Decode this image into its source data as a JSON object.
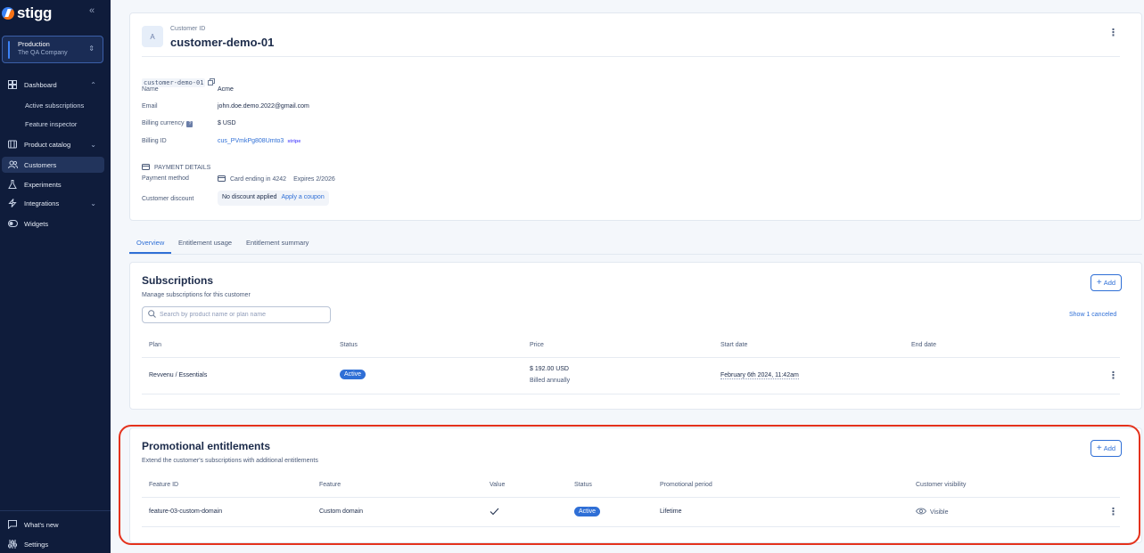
{
  "sidebar": {
    "logo_text": "stigg",
    "environment": {
      "name": "Production",
      "company": "The QA Company"
    },
    "items": [
      {
        "label": "Dashboard"
      },
      {
        "label": "Active subscriptions"
      },
      {
        "label": "Feature inspector"
      },
      {
        "label": "Product catalog"
      },
      {
        "label": "Customers"
      },
      {
        "label": "Experiments"
      },
      {
        "label": "Integrations"
      },
      {
        "label": "Widgets"
      }
    ],
    "bottom": [
      {
        "label": "What's new"
      },
      {
        "label": "Settings"
      }
    ]
  },
  "customer": {
    "avatar_letter": "A",
    "id_label": "Customer ID",
    "id": "customer-demo-01",
    "id_chip": "customer-demo-01",
    "fields": {
      "name_label": "Name",
      "name": "Acme",
      "email_label": "Email",
      "email": "john.doe.demo.2022@gmail.com",
      "currency_label": "Billing currency",
      "currency": "$ USD",
      "currency_badge": "?",
      "billing_id_label": "Billing ID",
      "billing_id": "cus_PVmkPg808Umto3",
      "billing_provider": "stripe"
    },
    "payment": {
      "section_label": "PAYMENT DETAILS",
      "method_label": "Payment method",
      "card": "Card ending in 4242",
      "expires": "Expires 2/2026"
    },
    "discount": {
      "label": "Customer discount",
      "value": "No discount applied",
      "action": "Apply a coupon"
    }
  },
  "tabs": [
    "Overview",
    "Entitlement usage",
    "Entitlement summary"
  ],
  "subscriptions": {
    "title": "Subscriptions",
    "subtitle": "Manage subscriptions for this customer",
    "add_label": "Add",
    "search_placeholder": "Search by product name or plan name",
    "show_canceled": "Show 1 canceled",
    "columns": [
      "Plan",
      "Status",
      "Price",
      "Start date",
      "End date"
    ],
    "rows": [
      {
        "plan": "Revvenu / Essentials",
        "status": "Active",
        "price": "$ 192.00 USD",
        "billing": "Billed annually",
        "start_date": "February 6th 2024, 11:42am",
        "end_date": ""
      }
    ]
  },
  "promotional": {
    "title": "Promotional entitlements",
    "subtitle": "Extend the customer's subscriptions with additional entitlements",
    "add_label": "Add",
    "columns": [
      "Feature ID",
      "Feature",
      "Value",
      "Status",
      "Promotional period",
      "Customer visibility"
    ],
    "rows": [
      {
        "feature_id": "feature-03-custom-domain",
        "feature": "Custom domain",
        "value_icon": "check-icon",
        "status": "Active",
        "period": "Lifetime",
        "visibility": "Visible"
      }
    ]
  },
  "colors": {
    "sidebar_bg": "#0f1c3b",
    "accent": "#2f6fd6",
    "highlight": "#e4321c"
  }
}
